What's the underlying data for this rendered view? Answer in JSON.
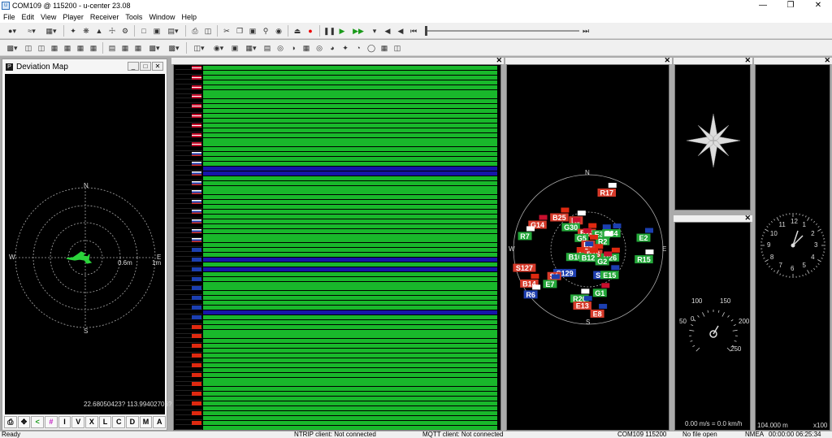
{
  "window": {
    "title": "COM109 @ 115200 - u-center 23.08"
  },
  "menu": [
    "File",
    "Edit",
    "View",
    "Player",
    "Receiver",
    "Tools",
    "Window",
    "Help"
  ],
  "deviation_map": {
    "title": "Deviation Map",
    "coord": "22.68050423? 113.99402706?",
    "north": "N",
    "south": "S",
    "east": "E",
    "west": "W",
    "ring_label_inner": "0.6m",
    "ring_label_outer": "1m",
    "footer_buttons": [
      "I",
      "V",
      "X",
      "L",
      "C",
      "D",
      "M",
      "A"
    ]
  },
  "sky": {
    "north": "N",
    "south": "S",
    "east": "E",
    "west": "W",
    "sats": [
      {
        "id": "R17",
        "az": 18,
        "el": 18,
        "color": "#d63a2a",
        "flag": "ru"
      },
      {
        "id": "B25",
        "az": 318,
        "el": 38,
        "color": "#d63a2a",
        "flag": "cn"
      },
      {
        "id": "R9",
        "az": 337,
        "el": 52,
        "color": "#d63a2a",
        "flag": "ru"
      },
      {
        "id": "G30",
        "az": 322,
        "el": 56,
        "color": "#24a83a",
        "flag": "us"
      },
      {
        "id": "G14",
        "az": 296,
        "el": 22,
        "color": "#d63a2a",
        "flag": "us"
      },
      {
        "id": "B24",
        "az": 355,
        "el": 70,
        "color": "#d63a2a",
        "flag": "cn"
      },
      {
        "id": "G5",
        "az": 330,
        "el": 74,
        "color": "#24a83a",
        "flag": "us"
      },
      {
        "id": "E30",
        "az": 40,
        "el": 66,
        "color": "#24a83a",
        "flag": "eu"
      },
      {
        "id": "E34",
        "az": 55,
        "el": 56,
        "color": "#24a83a",
        "flag": "eu"
      },
      {
        "id": "R2",
        "az": 60,
        "el": 70,
        "color": "#24a83a",
        "flag": "ru"
      },
      {
        "id": "R7",
        "az": 282,
        "el": 12,
        "color": "#24a83a",
        "flag": "ru"
      },
      {
        "id": "B9",
        "az": 0,
        "el": 84,
        "color": "#d63a2a",
        "flag": "cn"
      },
      {
        "id": "E7",
        "az": 250,
        "el": 84,
        "color": "#d63a2a",
        "flag": "eu"
      },
      {
        "id": "E2",
        "az": 78,
        "el": 22,
        "color": "#24a83a",
        "flag": "eu"
      },
      {
        "id": "B10",
        "az": 240,
        "el": 72,
        "color": "#24a83a",
        "flag": "cn"
      },
      {
        "id": "B16",
        "az": 130,
        "el": 82,
        "color": "#d63a2a",
        "flag": "cn"
      },
      {
        "id": "B26",
        "az": 110,
        "el": 62,
        "color": "#24a83a",
        "flag": "cn"
      },
      {
        "id": "G2",
        "az": 130,
        "el": 68,
        "color": "#24a83a",
        "flag": "us"
      },
      {
        "id": "S127",
        "az": 254,
        "el": 10,
        "color": "#d63a2a",
        "flag": "none"
      },
      {
        "id": "B12",
        "az": 180,
        "el": 80,
        "color": "#24a83a",
        "flag": "cn"
      },
      {
        "id": "R15",
        "az": 100,
        "el": 22,
        "color": "#24a83a",
        "flag": "ru"
      },
      {
        "id": "S129",
        "az": 225,
        "el": 50,
        "color": "#1e3fb0",
        "flag": "none"
      },
      {
        "id": "S1",
        "az": 155,
        "el": 56,
        "color": "#1e3fb0",
        "flag": "none"
      },
      {
        "id": "E15",
        "az": 140,
        "el": 50,
        "color": "#24a83a",
        "flag": "eu"
      },
      {
        "id": "S1",
        "az": 232,
        "el": 38,
        "color": "#d63a2a",
        "flag": "none"
      },
      {
        "id": "E7",
        "az": 228,
        "el": 28,
        "color": "#24a83a",
        "flag": "eu"
      },
      {
        "id": "B14",
        "az": 240,
        "el": 8,
        "color": "#d63a2a",
        "flag": "cn"
      },
      {
        "id": "G1",
        "az": 165,
        "el": 36,
        "color": "#24a83a",
        "flag": "us"
      },
      {
        "id": "R6",
        "az": 232,
        "el": 2,
        "color": "#1e3fb0",
        "flag": "ru"
      },
      {
        "id": "R20",
        "az": 190,
        "el": 30,
        "color": "#24a83a",
        "flag": "ru"
      },
      {
        "id": "E13",
        "az": 186,
        "el": 22,
        "color": "#d63a2a",
        "flag": "eu"
      },
      {
        "id": "E8",
        "az": 172,
        "el": 12,
        "color": "#d63a2a",
        "flag": "eu"
      }
    ]
  },
  "speedometer": {
    "ticks": [
      "0",
      "50",
      "100",
      "150",
      "200",
      "250"
    ],
    "readout": "0.00 m/s = 0.0 km/h"
  },
  "clock": {
    "numbers": [
      "12",
      "1",
      "2",
      "3",
      "4",
      "5",
      "6",
      "7",
      "8",
      "9",
      "10",
      "11"
    ],
    "altitude": "104.000 m",
    "scale": "x100"
  },
  "levels": {
    "bands": [
      "ru",
      "ru",
      "ru",
      "ru",
      "ru",
      "ru",
      "ru",
      "ru",
      "ru",
      "ru",
      "ru",
      "ru",
      "ru",
      "ru",
      "ru",
      "ru",
      "ru",
      "ru",
      "ru",
      "ru",
      "ru",
      "ru",
      "ru",
      "ru",
      "ru",
      "ru",
      "ru",
      "ru",
      "ru",
      "ru",
      "ru",
      "ru",
      "ru",
      "ru",
      "ru",
      "ru",
      "ru",
      "ru",
      "ru",
      "ru",
      "ru",
      "ru",
      "ru",
      "ru",
      "ru",
      "ru",
      "ru",
      "ru",
      "ru",
      "ru",
      "ru",
      "ru",
      "ru",
      "ru",
      "ru",
      "ru",
      "ru",
      "ru",
      "ru",
      "ru",
      "ru",
      "ru",
      "ru",
      "ru",
      "ru",
      "ru",
      "ru",
      "ru",
      "ru",
      "ru",
      "ru",
      "ru",
      "ru",
      "ru",
      "ru",
      "ru"
    ]
  },
  "status": {
    "left": "Ready",
    "ntrip": "NTRIP client: Not connected",
    "mqtt": "MQTT client: Not connected",
    "port": "COM109 115200",
    "file": "No file open",
    "proto": "NMEA",
    "time": "00:00:00 06:25:34"
  },
  "colors": {
    "green": "#19b82b",
    "blue": "#1616a8"
  }
}
